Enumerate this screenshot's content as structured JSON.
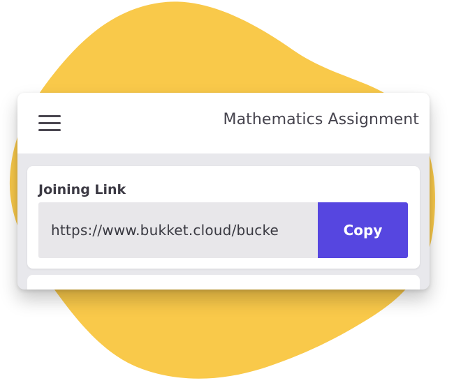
{
  "header": {
    "title": "Mathematics Assignment",
    "menu_icon": "hamburger-menu-icon"
  },
  "joining_link": {
    "label": "Joining Link",
    "url": "https://www.bukket.cloud/bucke",
    "copy_label": "Copy"
  },
  "colors": {
    "blob": "#f9c94a",
    "accent": "#5646e0",
    "field_background": "#e8e7ea",
    "card_background": "#e8e8ec"
  }
}
